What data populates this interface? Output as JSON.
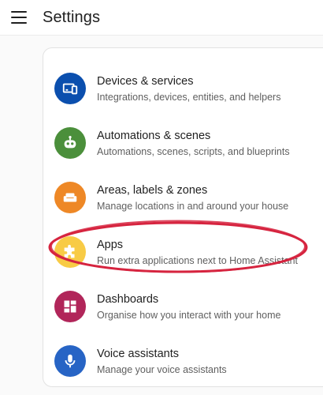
{
  "header": {
    "title": "Settings",
    "menu_icon": "hamburger-menu-icon"
  },
  "settings": {
    "items": [
      {
        "label": "Devices & services",
        "description": "Integrations, devices, entities, and helpers",
        "icon": "devices-icon",
        "color": "#0b4fae"
      },
      {
        "label": "Automations & scenes",
        "description": "Automations, scenes, scripts, and blueprints",
        "icon": "robot-icon",
        "color": "#4b8f3b"
      },
      {
        "label": "Areas, labels & zones",
        "description": "Manage locations in and around your house",
        "icon": "sofa-icon",
        "color": "#ee8826"
      },
      {
        "label": "Apps",
        "description": "Run extra applications next to Home Assistant",
        "icon": "puzzle-icon",
        "color": "#f8cb45"
      },
      {
        "label": "Dashboards",
        "description": "Organise how you interact with your home",
        "icon": "dashboard-icon",
        "color": "#b1265a"
      },
      {
        "label": "Voice assistants",
        "description": "Manage your voice assistants",
        "icon": "microphone-icon",
        "color": "#2764c5"
      }
    ]
  },
  "annotation": {
    "color": "#d6243f"
  }
}
